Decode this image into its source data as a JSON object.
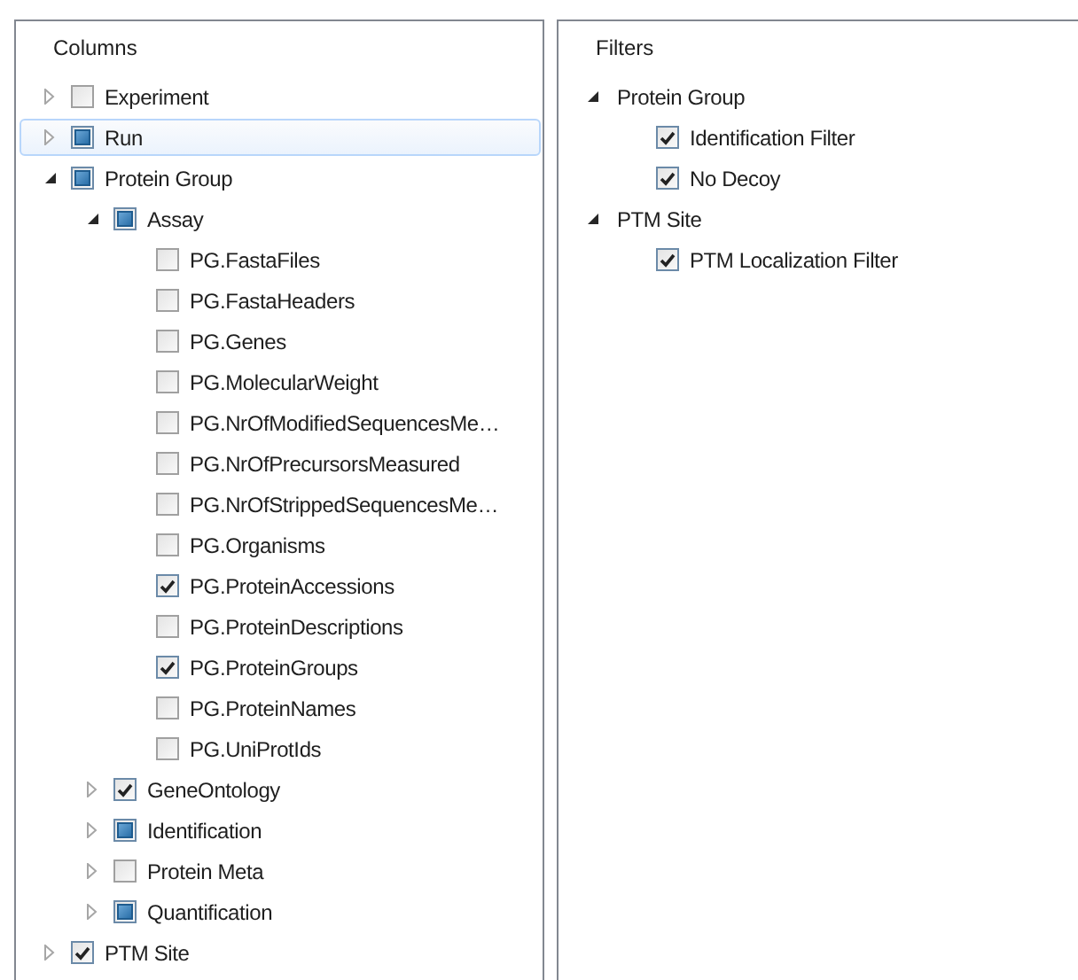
{
  "columns_panel": {
    "title": "Columns",
    "items": [
      {
        "label": "Experiment",
        "checked": false,
        "indeterminate": false,
        "expanded": false,
        "selected": false
      },
      {
        "label": "Run",
        "checked": false,
        "indeterminate": true,
        "expanded": false,
        "selected": true
      },
      {
        "label": "Protein Group",
        "checked": false,
        "indeterminate": true,
        "expanded": true,
        "selected": false,
        "children": [
          {
            "label": "Assay",
            "checked": false,
            "indeterminate": true,
            "expanded": true,
            "selected": false,
            "children": [
              {
                "label": "PG.FastaFiles",
                "checked": false,
                "indeterminate": false,
                "selected": false
              },
              {
                "label": "PG.FastaHeaders",
                "checked": false,
                "indeterminate": false,
                "selected": false
              },
              {
                "label": "PG.Genes",
                "checked": false,
                "indeterminate": false,
                "selected": false
              },
              {
                "label": "PG.MolecularWeight",
                "checked": false,
                "indeterminate": false,
                "selected": false
              },
              {
                "label": "PG.NrOfModifiedSequencesMe…",
                "checked": false,
                "indeterminate": false,
                "selected": false
              },
              {
                "label": "PG.NrOfPrecursorsMeasured",
                "checked": false,
                "indeterminate": false,
                "selected": false
              },
              {
                "label": "PG.NrOfStrippedSequencesMe…",
                "checked": false,
                "indeterminate": false,
                "selected": false
              },
              {
                "label": "PG.Organisms",
                "checked": false,
                "indeterminate": false,
                "selected": false
              },
              {
                "label": "PG.ProteinAccessions",
                "checked": true,
                "indeterminate": false,
                "selected": false
              },
              {
                "label": "PG.ProteinDescriptions",
                "checked": false,
                "indeterminate": false,
                "selected": false
              },
              {
                "label": "PG.ProteinGroups",
                "checked": true,
                "indeterminate": false,
                "selected": false
              },
              {
                "label": "PG.ProteinNames",
                "checked": false,
                "indeterminate": false,
                "selected": false
              },
              {
                "label": "PG.UniProtIds",
                "checked": false,
                "indeterminate": false,
                "selected": false
              }
            ]
          },
          {
            "label": "GeneOntology",
            "checked": true,
            "indeterminate": false,
            "expanded": false,
            "selected": false
          },
          {
            "label": "Identification",
            "checked": false,
            "indeterminate": true,
            "expanded": false,
            "selected": false
          },
          {
            "label": "Protein Meta",
            "checked": false,
            "indeterminate": false,
            "expanded": false,
            "selected": false
          },
          {
            "label": "Quantification",
            "checked": false,
            "indeterminate": true,
            "expanded": false,
            "selected": false
          }
        ]
      },
      {
        "label": "PTM Site",
        "checked": true,
        "indeterminate": false,
        "expanded": false,
        "selected": false
      }
    ]
  },
  "filters_panel": {
    "title": "Filters",
    "items": [
      {
        "label": "Protein Group",
        "expanded": true,
        "selected": false,
        "children": [
          {
            "label": "Identification Filter",
            "checked": true,
            "selected": false
          },
          {
            "label": "No Decoy",
            "checked": true,
            "selected": false
          }
        ]
      },
      {
        "label": "PTM Site",
        "expanded": true,
        "selected": false,
        "children": [
          {
            "label": "PTM Localization Filter",
            "checked": true,
            "selected": false
          }
        ]
      }
    ]
  }
}
